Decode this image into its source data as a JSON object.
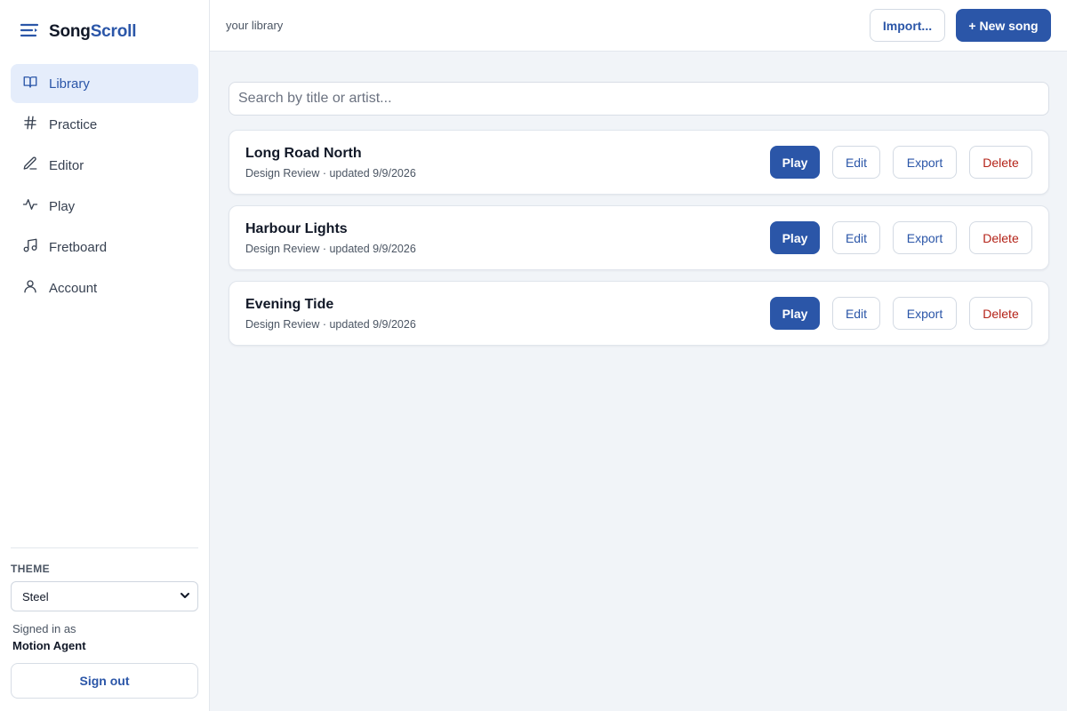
{
  "app": {
    "name_part1": "Song",
    "name_part2": "Scroll"
  },
  "sidebar": {
    "items": [
      {
        "label": "Library",
        "icon": "book-icon",
        "active": true
      },
      {
        "label": "Practice",
        "icon": "hash-icon",
        "active": false
      },
      {
        "label": "Editor",
        "icon": "pencil-icon",
        "active": false
      },
      {
        "label": "Play",
        "icon": "waveform-icon",
        "active": false
      },
      {
        "label": "Fretboard",
        "icon": "music-note-icon",
        "active": false
      },
      {
        "label": "Account",
        "icon": "user-icon",
        "active": false
      }
    ],
    "theme_label": "THEME",
    "theme_value": "Steel",
    "signed_in_label": "Signed in as",
    "user_name": "Motion Agent",
    "sign_out_label": "Sign out"
  },
  "topbar": {
    "subtitle": "your library",
    "import_label": "Import...",
    "new_song_label": "+ New song"
  },
  "search": {
    "placeholder": "Search by title or artist..."
  },
  "songs": [
    {
      "title": "Long Road North",
      "meta": "Design Review · updated 9/9/2026"
    },
    {
      "title": "Harbour Lights",
      "meta": "Design Review · updated 9/9/2026"
    },
    {
      "title": "Evening Tide",
      "meta": "Design Review · updated 9/9/2026"
    }
  ],
  "song_actions": {
    "play": "Play",
    "edit": "Edit",
    "export": "Export",
    "delete": "Delete"
  },
  "colors": {
    "accent": "#2b56a8",
    "active_bg": "#e5edfb",
    "danger": "#b42318",
    "page_bg": "#f1f4f8"
  }
}
